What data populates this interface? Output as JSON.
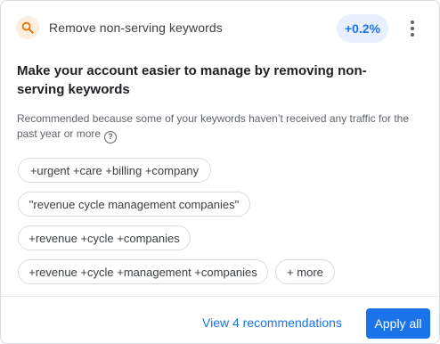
{
  "header": {
    "icon": "search-icon",
    "title": "Remove non-serving keywords",
    "impact": "+0.2%",
    "menu_icon": "more-vert-icon"
  },
  "headline": "Make your account easier to manage by removing non-serving keywords",
  "reason": {
    "text": "Recommended because some of your keywords haven’t received any traffic for the past year or more",
    "icon": "help-icon",
    "icon_glyph": "?"
  },
  "keywords": [
    "+urgent +care +billing +company",
    "\"revenue cycle management companies\"",
    "+revenue +cycle +companies",
    "+revenue +cycle +management +companies"
  ],
  "more_chip": "+ more",
  "footer": {
    "view_link": "View 4 recommendations",
    "apply_button": "Apply all"
  },
  "colors": {
    "accent": "#1a73e8",
    "badge_bg": "#e8f0fe",
    "icon_bg": "#fdeee0",
    "icon_fg": "#e37400"
  }
}
